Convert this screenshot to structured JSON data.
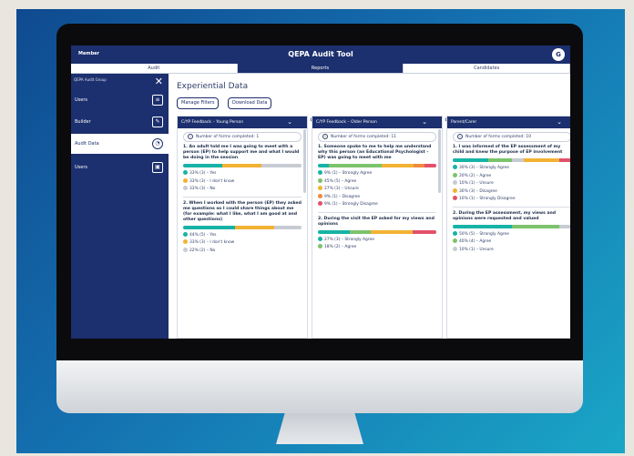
{
  "app": {
    "brand": "Member",
    "title": "QEPA Audit Tool",
    "avatar_initial": "G"
  },
  "tabs": [
    {
      "label": "Audit",
      "active": false
    },
    {
      "label": "Reports",
      "active": true
    },
    {
      "label": "Candidates",
      "active": false
    }
  ],
  "sidebar": {
    "header": "QEPA Audit Group",
    "close_glyph": "✕",
    "items": [
      {
        "label": "Users",
        "icon": "list-icon",
        "glyph": "≡",
        "selected": false
      },
      {
        "label": "Builder",
        "icon": "edit-icon",
        "glyph": "✎",
        "selected": false
      },
      {
        "label": "Audit Data",
        "icon": "chart-icon",
        "glyph": "◔",
        "selected": true
      },
      {
        "label": "Users",
        "icon": "user-icon",
        "glyph": "▣",
        "selected": false
      }
    ]
  },
  "main": {
    "heading": "Experiential Data",
    "manage_filters": "Manage Filters",
    "download_data": "Download Data"
  },
  "colors": {
    "navy": "#1c2f6e",
    "teal": "#17b3a6",
    "green": "#7cc36b",
    "amber": "#f2b233",
    "orange": "#f08a3c",
    "red": "#e3506a",
    "grey": "#c7cbd3"
  },
  "cards": [
    {
      "title": "C/YP Feedback – Young Person",
      "count": "Number of forms completed: 1",
      "questions": [
        {
          "text": "1. An adult told me I was going to meet with a person (EP) to help support me and what I would be doing in the session",
          "bar": [
            {
              "pct": 33,
              "color": "#17b3a6"
            },
            {
              "pct": 33,
              "color": "#f2b233"
            },
            {
              "pct": 34,
              "color": "#c7cbd3"
            }
          ],
          "legend": [
            {
              "text": "33% (3) – Yes",
              "color": "#17b3a6"
            },
            {
              "text": "33% (3) – I don't know",
              "color": "#f2b233"
            },
            {
              "text": "33% (3) – No",
              "color": "#c7cbd3"
            }
          ]
        },
        {
          "text": "2. When I worked with the person (EP) they asked me questions so I could share things about me (for example: what I like, what I am good at and other questions)",
          "bar": [
            {
              "pct": 44,
              "color": "#17b3a6"
            },
            {
              "pct": 33,
              "color": "#f2b233"
            },
            {
              "pct": 23,
              "color": "#c7cbd3"
            }
          ],
          "legend": [
            {
              "text": "44% (5) – Yes",
              "color": "#17b3a6"
            },
            {
              "text": "33% (3) – I don't know",
              "color": "#f2b233"
            },
            {
              "text": "22% (2) – No",
              "color": "#c7cbd3"
            }
          ]
        }
      ]
    },
    {
      "title": "C/YP Feedback – Older Person",
      "count": "Number of forms completed: 11",
      "questions": [
        {
          "text": "1. Someone spoke to me to help me understand why this person (an Educational Psychologist – EP) was going to meet with me",
          "bar": [
            {
              "pct": 9,
              "color": "#17b3a6"
            },
            {
              "pct": 45,
              "color": "#7cc36b"
            },
            {
              "pct": 27,
              "color": "#f2b233"
            },
            {
              "pct": 9,
              "color": "#f08a3c"
            },
            {
              "pct": 10,
              "color": "#e3506a"
            }
          ],
          "legend": [
            {
              "text": "9% (1) – Strongly Agree",
              "color": "#17b3a6"
            },
            {
              "text": "45% (5) – Agree",
              "color": "#7cc36b"
            },
            {
              "text": "27% (3) – Unsure",
              "color": "#f2b233"
            },
            {
              "text": "9% (1) – Disagree",
              "color": "#f08a3c"
            },
            {
              "text": "9% (1) – Strongly Disagree",
              "color": "#e3506a"
            }
          ]
        },
        {
          "text": "2. During the visit the EP asked for my views and opinions",
          "bar": [
            {
              "pct": 27,
              "color": "#17b3a6"
            },
            {
              "pct": 18,
              "color": "#7cc36b"
            },
            {
              "pct": 35,
              "color": "#f2b233"
            },
            {
              "pct": 20,
              "color": "#e3506a"
            }
          ],
          "legend": [
            {
              "text": "27% (3) – Strongly Agree",
              "color": "#17b3a6"
            },
            {
              "text": "18% (2) – Agree",
              "color": "#7cc36b"
            }
          ]
        }
      ]
    },
    {
      "title": "Parent/Carer",
      "count": "Number of forms completed: 10",
      "questions": [
        {
          "text": "1. I was informed of the EP assessment of my child and knew the purpose of EP involvement",
          "bar": [
            {
              "pct": 30,
              "color": "#17b3a6"
            },
            {
              "pct": 20,
              "color": "#7cc36b"
            },
            {
              "pct": 10,
              "color": "#c7cbd3"
            },
            {
              "pct": 30,
              "color": "#f2b233"
            },
            {
              "pct": 10,
              "color": "#e3506a"
            }
          ],
          "legend": [
            {
              "text": "30% (3) – Strongly Agree",
              "color": "#17b3a6"
            },
            {
              "text": "20% (2) – Agree",
              "color": "#7cc36b"
            },
            {
              "text": "10% (1) – Unsure",
              "color": "#c7cbd3"
            },
            {
              "text": "30% (3) – Disagree",
              "color": "#f2b233"
            },
            {
              "text": "10% (1) – Strongly Disagree",
              "color": "#e3506a"
            }
          ]
        },
        {
          "text": "2. During the EP assessment, my views and opinions were requested and valued",
          "bar": [
            {
              "pct": 50,
              "color": "#17b3a6"
            },
            {
              "pct": 40,
              "color": "#7cc36b"
            },
            {
              "pct": 10,
              "color": "#c7cbd3"
            }
          ],
          "legend": [
            {
              "text": "50% (5) – Strongly Agree",
              "color": "#17b3a6"
            },
            {
              "text": "40% (4) – Agree",
              "color": "#7cc36b"
            },
            {
              "text": "10% (1) – Unsure",
              "color": "#c7cbd3"
            }
          ]
        }
      ]
    }
  ]
}
